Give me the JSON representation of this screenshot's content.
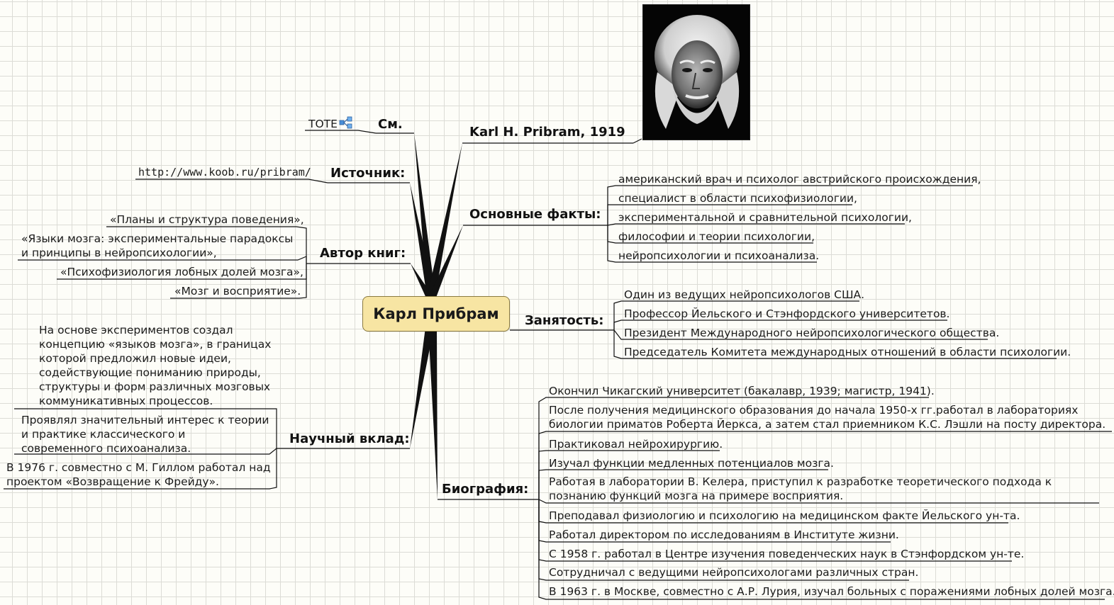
{
  "central_topic": "Карл Прибрам",
  "branches": {
    "see": {
      "label": "См.",
      "leaves": [
        "TOTE"
      ],
      "icon": "link-icon"
    },
    "source": {
      "label": "Источник:",
      "leaves": [
        "http://www.koob.ru/pribram/"
      ]
    },
    "books": {
      "label": "Автор книг:",
      "leaves": [
        "«Планы и структура поведения»,",
        "«Языки мозга: экспериментальные парадоксы и принципы в нейропсихологии»,",
        "«Психофизиология лобных долей мозга»,",
        "«Мозг и восприятие»."
      ]
    },
    "contribution": {
      "label": "Научный вклад:",
      "leaves": [
        "На основе экспериментов создал концепцию «языков мозга», в границах которой предложил новые идеи, содействующие пониманию природы, структуры и форм различных мозговых коммуникативных процессов.",
        "Проявлял значительный интерес к теории и практике классического и современного психоанализа.",
        "В 1976 г. совместно с М. Гиллом работал над проектом «Возвращение к Фрейду»."
      ]
    },
    "name": {
      "label": "Karl H. Pribram, 1919",
      "image": "portrait-photo"
    },
    "facts": {
      "label": "Основные факты:",
      "leaves": [
        "американский врач и психолог австрийского происхождения,",
        "специалист в области психофизиологии,",
        "экспериментальной и сравнительной психологии,",
        "философии и теории психологии,",
        "нейропсихологии и психоанализа."
      ]
    },
    "occupation": {
      "label": "Занятость:",
      "leaves": [
        "Один из ведущих нейропсихологов США.",
        "Профессор Йельского и Стэнфордского  университетов.",
        "Президент Международного нейропсихологического общества.",
        "Председатель Комитета международных отношений в области психологии."
      ]
    },
    "biography": {
      "label": "Биография:",
      "leaves": [
        "Окончил Чикагский университет  (бакалавр, 1939; магистр, 1941).",
        "После получения медицинского образования до начала 1950-х гг.работал в лабораториях биологии приматов Роберта Йеркса, а затем стал приемником К.С. Лэшли на посту директора.",
        "Практиковал нейрохирургию.",
        "Изучал функции медленных потенциалов мозга.",
        "Работая в лаборатории В. Келера, приступил к разработке теоретического подхода к познанию функций мозга на примере восприятия.",
        "Преподавал физиологию и психологию на медицинском факте Йельского ун-та.",
        "Работал директором по исследованиям в Институте жизни.",
        "С 1958 г. работал в Центре изучения поведенческих наук в Стэнфордском ун-те.",
        "Сотрудничал с ведущими нейропсихологами различных стран.",
        "В 1963 г. в Москве, совместно с А.Р. Лурия, изучал больных с поражениями лобных долей мозга."
      ]
    }
  },
  "colors": {
    "central_fill": "#f7e5a3",
    "line": "#1a1a1a",
    "grid": "#dcdcd6",
    "background": "#fdfdf8"
  }
}
